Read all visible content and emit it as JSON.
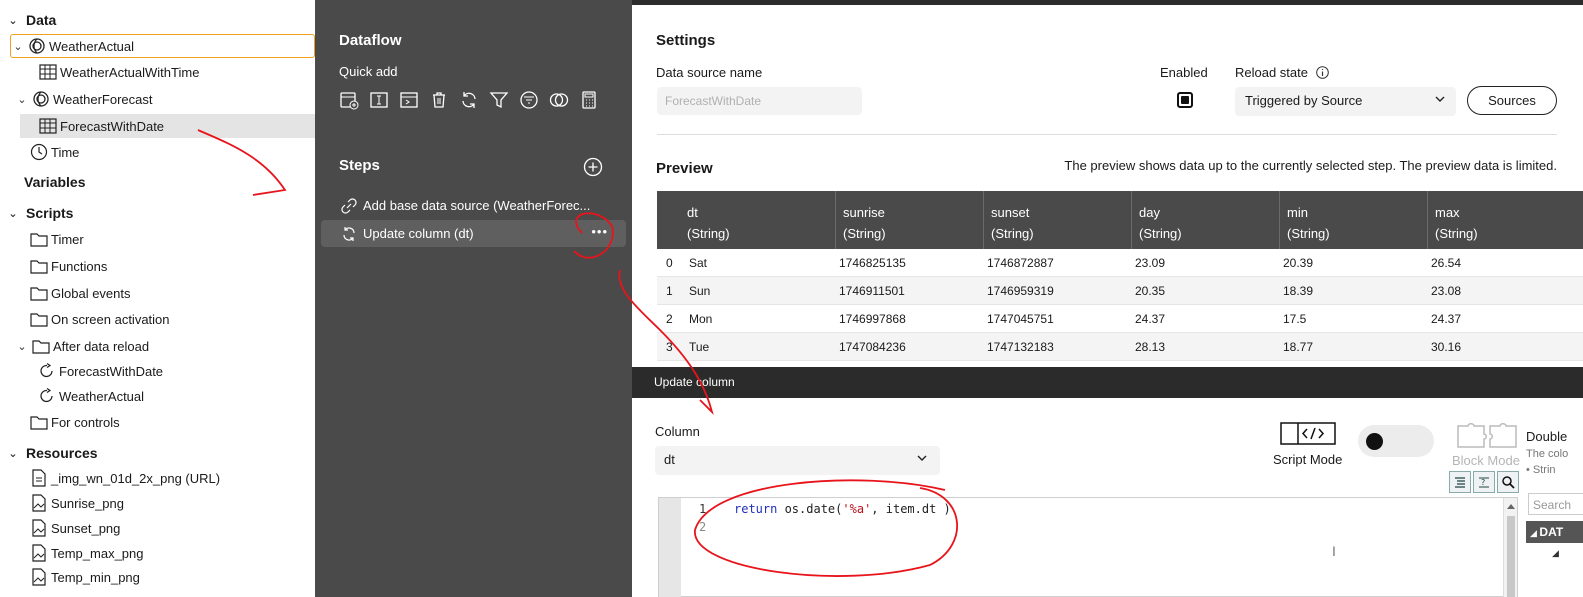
{
  "tree": {
    "data_header": "Data",
    "items": [
      {
        "label": "WeatherActual"
      },
      {
        "label": "WeatherActualWithTime"
      },
      {
        "label": "WeatherForecast"
      },
      {
        "label": "ForecastWithDate"
      },
      {
        "label": "Time"
      }
    ],
    "variables_header": "Variables",
    "scripts_header": "Scripts",
    "scripts": [
      {
        "label": "Timer"
      },
      {
        "label": "Functions"
      },
      {
        "label": "Global events"
      },
      {
        "label": "On screen activation"
      },
      {
        "label": "After data reload"
      },
      {
        "label": "ForecastWithDate"
      },
      {
        "label": "WeatherActual"
      },
      {
        "label": "For controls"
      }
    ],
    "resources_header": "Resources",
    "resources": [
      {
        "label": "_img_wn_01d_2x_png (URL)"
      },
      {
        "label": "Sunrise_png"
      },
      {
        "label": "Sunset_png"
      },
      {
        "label": "Temp_max_png"
      },
      {
        "label": "Temp_min_png"
      }
    ]
  },
  "dataflow": {
    "title": "Dataflow",
    "quick_add": "Quick add",
    "quick_icons": [
      "add-datasource-icon",
      "add-text-column-icon",
      "add-column-icon",
      "delete-icon",
      "refresh-icon",
      "filter-icon",
      "filter-list-icon",
      "join-icon",
      "calculator-icon"
    ],
    "steps_title": "Steps",
    "steps": [
      {
        "label": "Add base data source (WeatherForec...",
        "icon": "link-icon"
      },
      {
        "label": "Update column (dt)",
        "icon": "sync-icon",
        "more": "•••"
      }
    ]
  },
  "settings": {
    "title": "Settings",
    "ds_name_label": "Data source name",
    "ds_name_value": "ForecastWithDate",
    "enabled_label": "Enabled",
    "reload_label": "Reload state",
    "reload_value": "Triggered by Source",
    "sources_button": "Sources"
  },
  "preview": {
    "title": "Preview",
    "note": "The preview shows data up to the currently selected step. The preview data is limited.",
    "columns": [
      {
        "name": "dt",
        "type": "(String)"
      },
      {
        "name": "sunrise",
        "type": "(String)"
      },
      {
        "name": "sunset",
        "type": "(String)"
      },
      {
        "name": "day",
        "type": "(String)"
      },
      {
        "name": "min",
        "type": "(String)"
      },
      {
        "name": "max",
        "type": "(String)"
      }
    ],
    "rows": [
      {
        "idx": "0",
        "cells": [
          "Sat",
          "1746825135",
          "1746872887",
          "23.09",
          "20.39",
          "26.54"
        ]
      },
      {
        "idx": "1",
        "cells": [
          "Sun",
          "1746911501",
          "1746959319",
          "20.35",
          "18.39",
          "23.08"
        ]
      },
      {
        "idx": "2",
        "cells": [
          "Mon",
          "1746997868",
          "1747045751",
          "24.37",
          "17.5",
          "24.37"
        ]
      },
      {
        "idx": "3",
        "cells": [
          "Tue",
          "1747084236",
          "1747132183",
          "28.13",
          "18.77",
          "30.16"
        ]
      }
    ]
  },
  "update_column": {
    "bar_title": "Update column",
    "column_label": "Column",
    "column_value": "dt",
    "script_mode": "Script Mode",
    "block_mode": "Block Mode",
    "double_title": "Double",
    "double_sub": "The colo",
    "double_bullet": "• Strin",
    "search_placeholder": "Search",
    "dat_label": "DAT",
    "code_lines": [
      {
        "num": "1",
        "kw": "return",
        "rest_a": " os.date(",
        "str": "'%a'",
        "rest_b": ", item.dt )"
      },
      {
        "num": "2",
        "kw": "",
        "rest_a": "",
        "str": "",
        "rest_b": ""
      }
    ]
  }
}
